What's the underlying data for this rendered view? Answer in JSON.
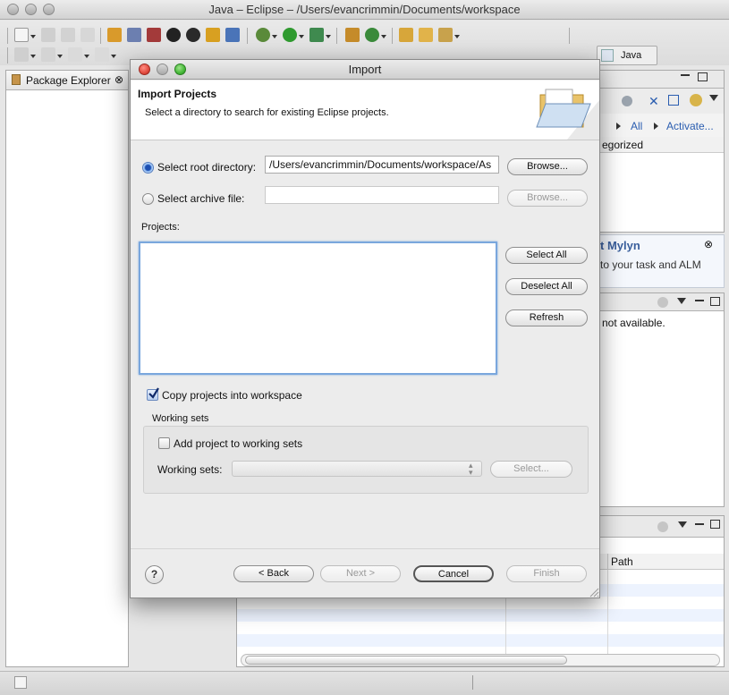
{
  "window": {
    "title": "Java – Eclipse – /Users/evancrimmin/Documents/workspace"
  },
  "perspective": {
    "label": "Java"
  },
  "package_explorer": {
    "tab_label": "Package Explorer",
    "close_glyph": "⊗"
  },
  "right_panel": {
    "all_label": "All",
    "activate_label": "Activate...",
    "categorized_fragment": "egorized",
    "mylyn_title_fragment": "t Mylyn",
    "mylyn_text_fragment": "to your task and ALM",
    "not_available_fragment": "not available.",
    "path_header": "Path"
  },
  "dialog": {
    "title": "Import",
    "banner_title": "Import Projects",
    "banner_description": "Select a directory to search for existing Eclipse projects.",
    "root_dir_label": "Select root directory:",
    "root_dir_value": "/Users/evancrimmin/Documents/workspace/As",
    "browse_label": "Browse...",
    "archive_label": "Select archive file:",
    "archive_value": "",
    "browse2_label": "Browse...",
    "projects_label": "Projects:",
    "select_all_label": "Select All",
    "deselect_all_label": "Deselect All",
    "refresh_label": "Refresh",
    "copy_projects_label": "Copy projects into workspace",
    "working_sets_group_label": "Working sets",
    "add_to_working_sets_label": "Add project to working sets",
    "working_sets_label": "Working sets:",
    "working_sets_value": "",
    "select_label": "Select...",
    "back_label": "< Back",
    "next_label": "Next >",
    "cancel_label": "Cancel",
    "finish_label": "Finish",
    "help_glyph": "?"
  },
  "state": {
    "root_dir_selected": true,
    "copy_projects_checked": true,
    "add_to_working_sets_checked": false
  },
  "colors": {
    "accent": "#3b74d6",
    "selection_focus": "#7aa7dd",
    "close_red": "#e14b3f",
    "minimize_yellow": "#e8b628",
    "zoom_green": "#45b838"
  }
}
